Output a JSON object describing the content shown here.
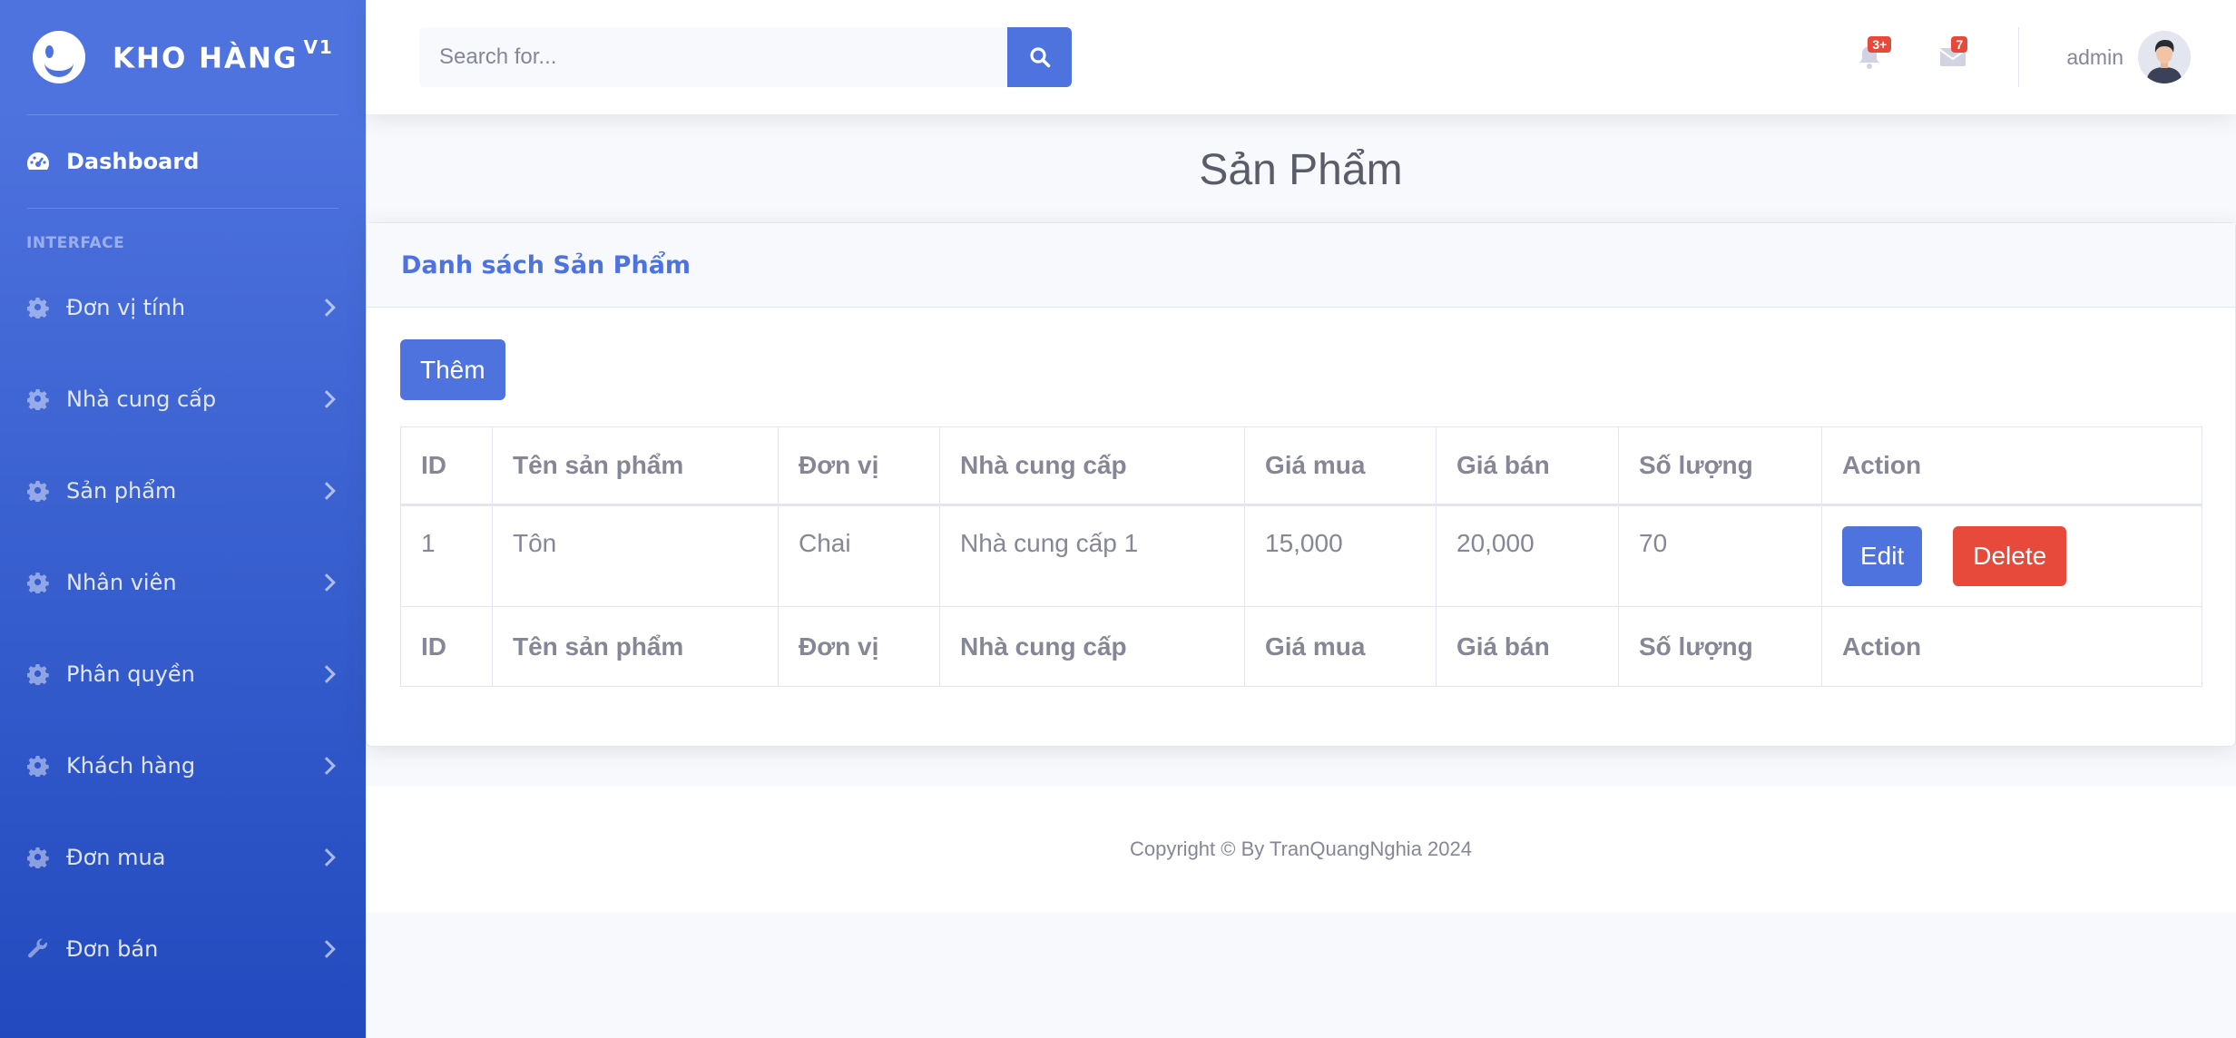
{
  "brand": {
    "name": "KHO HÀNG",
    "version": "V1"
  },
  "sidebar": {
    "dashboard": "Dashboard",
    "heading": "INTERFACE",
    "items": [
      {
        "label": "Đơn vị tính",
        "icon": "gear-icon"
      },
      {
        "label": "Nhà cung cấp",
        "icon": "gear-icon"
      },
      {
        "label": "Sản phẩm",
        "icon": "gear-icon"
      },
      {
        "label": "Nhân viên",
        "icon": "gear-icon"
      },
      {
        "label": "Phân quyền",
        "icon": "gear-icon"
      },
      {
        "label": "Khách hàng",
        "icon": "gear-icon"
      },
      {
        "label": "Đơn mua",
        "icon": "gear-icon"
      },
      {
        "label": "Đơn bán",
        "icon": "wrench-icon"
      }
    ]
  },
  "topbar": {
    "search_placeholder": "Search for...",
    "alerts_badge": "3+",
    "messages_badge": "7",
    "user_name": "admin"
  },
  "page": {
    "title": "Sản Phẩm"
  },
  "card": {
    "title": "Danh sách Sản Phẩm",
    "add_label": "Thêm"
  },
  "table": {
    "headers": [
      "ID",
      "Tên sản phẩm",
      "Đơn vị",
      "Nhà cung cấp",
      "Giá mua",
      "Giá bán",
      "Số lượng",
      "Action"
    ],
    "rows": [
      {
        "id": "1",
        "name": "Tôn",
        "unit": "Chai",
        "supplier": "Nhà cung cấp 1",
        "buy_price": "15,000",
        "sell_price": "20,000",
        "quantity": "70"
      }
    ],
    "edit_label": "Edit",
    "delete_label": "Delete"
  },
  "footer": {
    "copyright": "Copyright © By TranQuangNghia 2024"
  },
  "colors": {
    "primary": "#4e73df",
    "danger": "#e74a3b",
    "text": "#858796"
  }
}
